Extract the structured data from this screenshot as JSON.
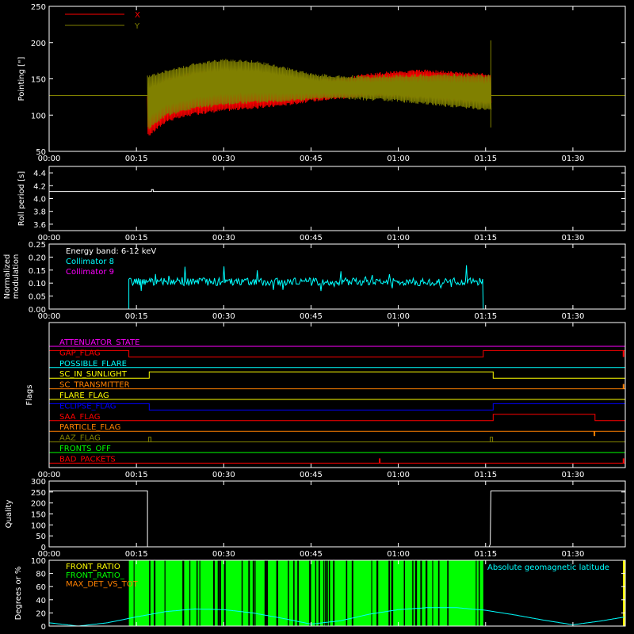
{
  "time_ticks": [
    "00:00",
    "00:15",
    "00:30",
    "00:45",
    "01:00",
    "01:15",
    "01:30"
  ],
  "time_range_min": [
    0,
    99
  ],
  "chart_data": [
    {
      "type": "line",
      "panel": "pointing",
      "ylabel": "Pointing [\"]",
      "ylim": [
        50,
        250
      ],
      "yticks": [
        "50",
        "100",
        "150",
        "200",
        "250"
      ],
      "legend": [
        {
          "label": "X",
          "color": "#ff0000"
        },
        {
          "label": "Y",
          "color": "#808000"
        }
      ],
      "series": [
        {
          "name": "X",
          "color": "#ff0000",
          "x_min": [
            17,
            20,
            25,
            30,
            35,
            40,
            45,
            50,
            55,
            60,
            65,
            70,
            75
          ],
          "upper": [
            130,
            152,
            160,
            163,
            160,
            152,
            148,
            152,
            158,
            162,
            163,
            160,
            158
          ],
          "lower": [
            70,
            90,
            100,
            105,
            108,
            112,
            118,
            122,
            125,
            124,
            122,
            118,
            115
          ]
        },
        {
          "name": "Y",
          "color": "#808000",
          "x_min": [
            17,
            20,
            25,
            30,
            35,
            40,
            45,
            50,
            55,
            60,
            65,
            70,
            75
          ],
          "upper": [
            155,
            162,
            172,
            178,
            176,
            168,
            158,
            155,
            155,
            156,
            157,
            157,
            156
          ],
          "lower": [
            80,
            98,
            108,
            113,
            116,
            118,
            120,
            122,
            120,
            118,
            114,
            110,
            106
          ]
        }
      ],
      "baseline": 127,
      "active_window_min": [
        16.9,
        75.9
      ],
      "spike_at_min": 75.9,
      "spike_range": [
        83,
        203
      ]
    },
    {
      "type": "line",
      "panel": "roll",
      "ylabel": "Roll period [s]",
      "ylim": [
        3.5,
        4.5
      ],
      "yticks": [
        "3.6",
        "3.8",
        "4.0",
        "4.2",
        "4.4"
      ],
      "series": [
        {
          "name": "",
          "color": "#ffffff",
          "x_min": [
            0,
            17.6,
            17.6,
            17.9,
            17.9,
            99
          ],
          "values": [
            4.11,
            4.11,
            4.14,
            4.14,
            4.11,
            4.11
          ]
        }
      ]
    },
    {
      "type": "line",
      "panel": "modulation",
      "ylabel": "Normalized modulation",
      "ylim": [
        0,
        0.25
      ],
      "yticks": [
        "0.00",
        "0.05",
        "0.10",
        "0.15",
        "0.20",
        "0.25"
      ],
      "annotation": "Energy band: 6-12 keV",
      "legend": [
        {
          "label": "Collimator 8",
          "color": "#00ffff"
        },
        {
          "label": "Collimator 9",
          "color": "#ff00ff"
        }
      ],
      "series": [
        {
          "name": "Collimator 8",
          "color": "#00ffff",
          "active_min": [
            13.7,
            74.6
          ],
          "mean": 0.105,
          "noise": 0.015
        },
        {
          "name": "Collimator 9",
          "color": "#ff00ff",
          "value": 0.0
        }
      ]
    },
    {
      "type": "line",
      "panel": "flags",
      "ylabel": "Flags",
      "flags": [
        {
          "label": "ATTENUATOR_STATE",
          "color": "#ff00ff",
          "steps": [
            [
              0,
              0
            ]
          ]
        },
        {
          "label": "GAP_FLAG",
          "color": "#ff0000",
          "steps": [
            [
              0,
              1
            ],
            [
              13.7,
              0
            ],
            [
              74.6,
              1
            ]
          ]
        },
        {
          "label": "POSSIBLE_FLARE",
          "color": "#00ffff",
          "steps": [
            [
              0,
              0
            ]
          ]
        },
        {
          "label": "SC_IN_SUNLIGHT",
          "color": "#ffff00",
          "steps": [
            [
              0,
              0
            ],
            [
              17.2,
              1
            ],
            [
              76.3,
              0
            ]
          ]
        },
        {
          "label": "SC_TRANSMITTER",
          "color": "#ff8000",
          "steps": [
            [
              0,
              0
            ]
          ]
        },
        {
          "label": "FLARE_FLAG",
          "color": "#ffff00",
          "steps": [
            [
              0,
              0
            ]
          ]
        },
        {
          "label": "ECLIPSE_FLAG",
          "color": "#0000ff",
          "steps": [
            [
              0,
              1
            ],
            [
              17.2,
              0
            ],
            [
              76.3,
              1
            ]
          ]
        },
        {
          "label": "SAA_FLAG",
          "color": "#ff0000",
          "steps": [
            [
              0,
              0
            ],
            [
              76.3,
              1
            ],
            [
              93.8,
              0
            ]
          ]
        },
        {
          "label": "PARTICLE_FLAG",
          "color": "#ff8000",
          "steps": [
            [
              0,
              0
            ]
          ]
        },
        {
          "label": "AAZ_FLAG",
          "color": "#808000",
          "steps": [
            [
              0,
              0
            ]
          ]
        },
        {
          "label": "FRONTS_OFF",
          "color": "#00ff00",
          "steps": [
            [
              0,
              0
            ]
          ]
        },
        {
          "label": "BAD_PACKETS",
          "color": "#ff0000",
          "steps": [
            [
              0,
              0
            ]
          ]
        }
      ]
    },
    {
      "type": "line",
      "panel": "quality",
      "ylabel": "Quality",
      "ylim": [
        0,
        300
      ],
      "yticks": [
        "0",
        "50",
        "100",
        "150",
        "200",
        "250",
        "300"
      ],
      "series": [
        {
          "name": "",
          "color": "#ffffff",
          "x_min": [
            0,
            16.9,
            16.9,
            75.6,
            75.8,
            75.9,
            99
          ],
          "values": [
            255,
            255,
            0,
            0,
            12,
            255,
            255
          ]
        }
      ]
    },
    {
      "type": "area",
      "panel": "front_ratio",
      "ylabel": "Degrees or %",
      "ylim": [
        0,
        100
      ],
      "yticks": [
        "0",
        "20",
        "40",
        "60",
        "80",
        "100"
      ],
      "legend": [
        {
          "label": "FRONT_RATIO",
          "color": "#ffff00"
        },
        {
          "label": "FRONT_RATIO_",
          "color": "#00ff00"
        },
        {
          "label": "MAX_DET_VS_TOT",
          "color": "#ff8000"
        }
      ],
      "annotation": "Absolute geomagnetic latitude",
      "annotation_color": "#00ffff",
      "green_window_min": [
        13.7,
        74.6
      ],
      "green_value": 100,
      "yellow_window_min": [
        98.6,
        99
      ],
      "yellow_value": 100,
      "latitude": {
        "name": "Absolute geomagnetic latitude",
        "color": "#00ffff",
        "x_min": [
          0,
          5,
          10,
          15,
          20,
          25,
          30,
          35,
          40,
          45,
          50,
          55,
          60,
          65,
          70,
          75,
          80,
          85,
          90,
          95,
          99
        ],
        "values": [
          5,
          0,
          5,
          14,
          22,
          26,
          25,
          20,
          12,
          3,
          8,
          18,
          25,
          28,
          28,
          24,
          17,
          9,
          2,
          8,
          14
        ]
      }
    }
  ]
}
